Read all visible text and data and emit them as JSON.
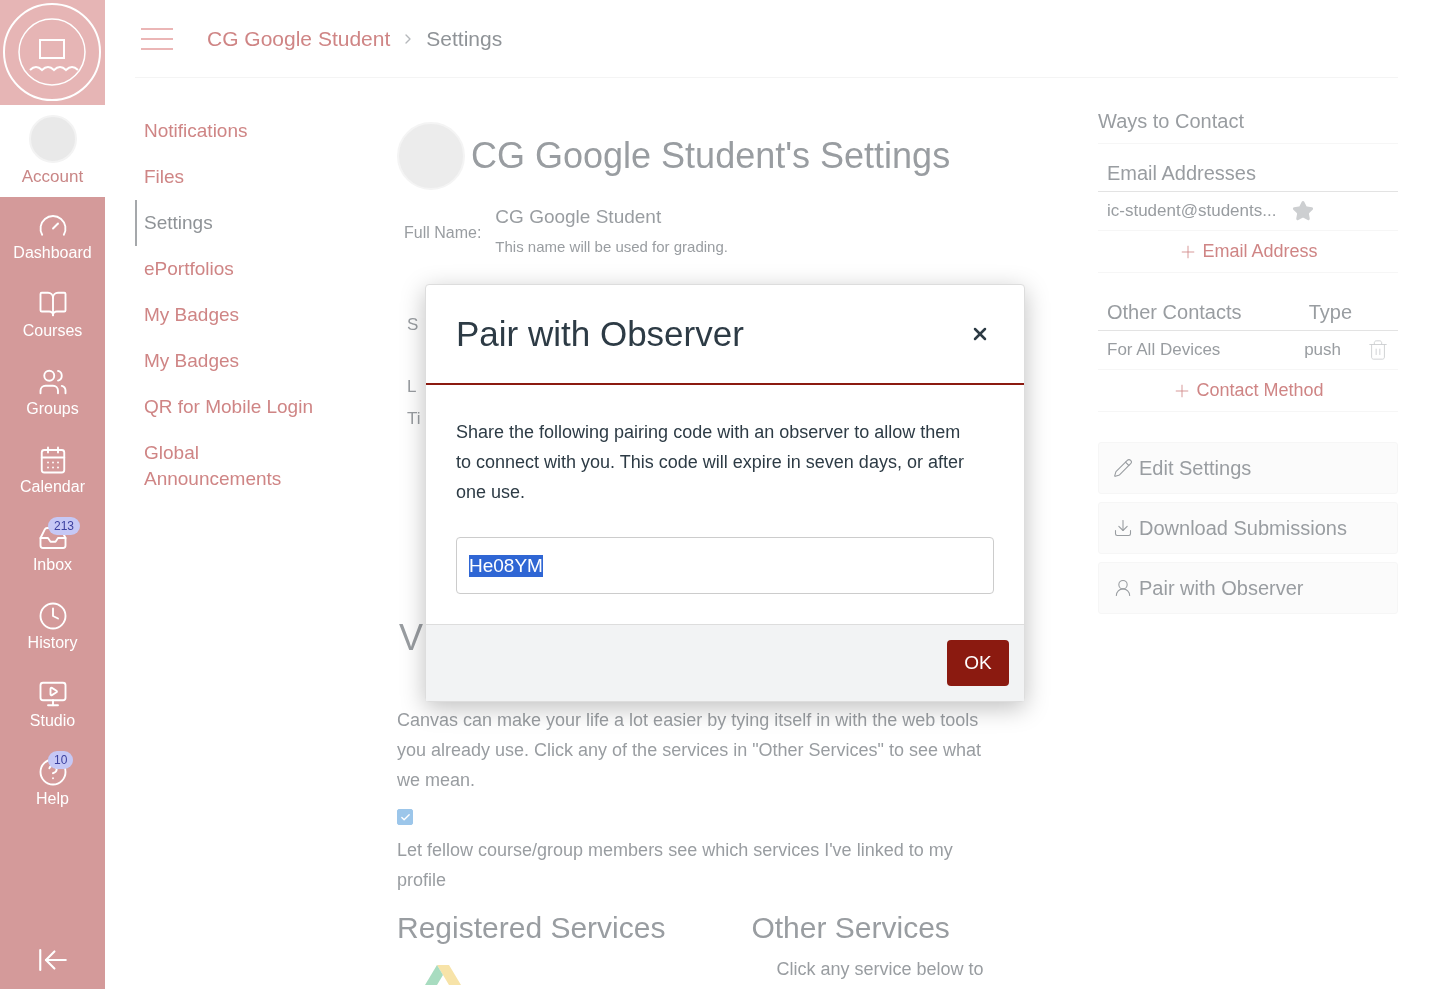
{
  "global_nav": {
    "account": {
      "label": "Account"
    },
    "items": [
      {
        "kind": "dashboard",
        "label": "Dashboard"
      },
      {
        "kind": "courses",
        "label": "Courses"
      },
      {
        "kind": "groups",
        "label": "Groups"
      },
      {
        "kind": "calendar",
        "label": "Calendar"
      },
      {
        "kind": "inbox",
        "label": "Inbox",
        "badge": "213"
      },
      {
        "kind": "history",
        "label": "History"
      },
      {
        "kind": "studio",
        "label": "Studio"
      },
      {
        "kind": "help",
        "label": "Help",
        "badge": "10"
      }
    ]
  },
  "breadcrumb": [
    "CG Google Student",
    "Settings"
  ],
  "section_nav": [
    {
      "label": "Notifications",
      "selected": false
    },
    {
      "label": "Files",
      "selected": false
    },
    {
      "label": "Settings",
      "selected": true
    },
    {
      "label": "ePortfolios",
      "selected": false
    },
    {
      "label": "My Badges",
      "selected": false
    },
    {
      "label": "My Badges",
      "selected": false
    },
    {
      "label": "QR for Mobile Login",
      "selected": false
    },
    {
      "label": "Global Announcements",
      "selected": false
    }
  ],
  "profile": {
    "title": "CG Google Student's Settings",
    "full_name_label": "Full Name:",
    "full_name": "CG Google Student",
    "full_name_hint": "This name will be used for grading.",
    "hidden_fragments": [
      "S",
      "L",
      "Ti"
    ],
    "web_heading_fragment": "V",
    "web_text": "Canvas can make your life a lot easier by tying itself in with the web tools you already use. Click any of the services in \"Other Services\" to see what we mean.",
    "share_checked": true,
    "share_label": "Let fellow course/group members see which services I've linked to my profile",
    "registered_heading": "Registered Services",
    "other_heading": "Other Services",
    "other_hint": "Click any service below to"
  },
  "ways_to_contact": {
    "title": "Ways to Contact",
    "email_heading": "Email Addresses",
    "emails": [
      "ic-student@students..."
    ],
    "add_email": "Email Address",
    "other_heading": "Other Contacts",
    "type_heading": "Type",
    "contacts": [
      {
        "name": "For All Devices",
        "type": "push"
      }
    ],
    "add_contact": "Contact Method"
  },
  "actions": [
    {
      "kind": "edit",
      "label": "Edit Settings"
    },
    {
      "kind": "download",
      "label": "Download Submissions"
    },
    {
      "kind": "observer",
      "label": "Pair with Observer"
    }
  ],
  "modal": {
    "title": "Pair with Observer",
    "text": "Share the following pairing code with an observer to allow them to connect with you. This code will expire in seven days, or after one use.",
    "code": "He08YM",
    "ok": "OK"
  }
}
